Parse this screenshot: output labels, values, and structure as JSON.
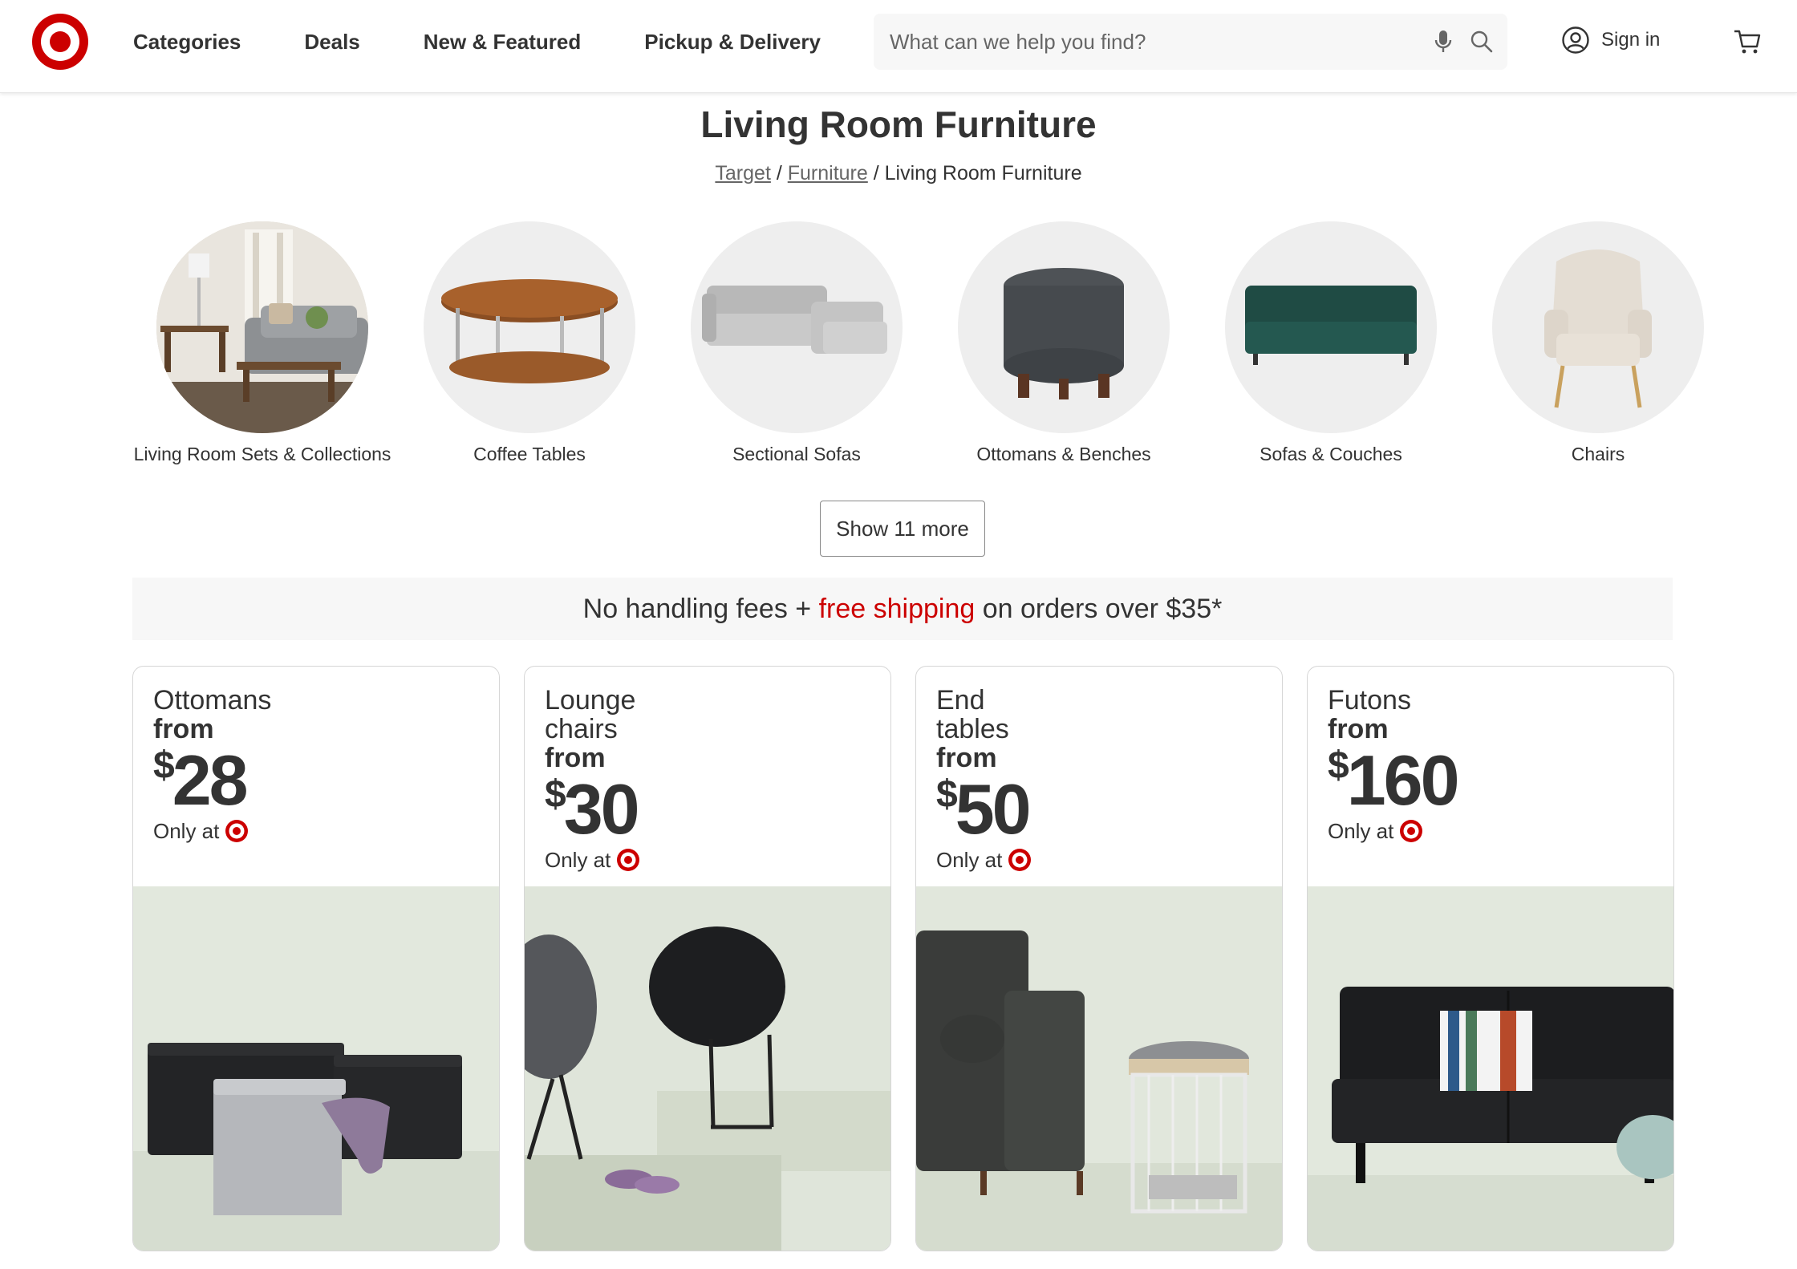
{
  "header": {
    "nav": [
      "Categories",
      "Deals",
      "New & Featured",
      "Pickup & Delivery"
    ],
    "search_placeholder": "What can we help you find?",
    "signin_label": "Sign in",
    "brand_color": "#cc0000"
  },
  "page": {
    "title": "Living Room Furniture",
    "breadcrumb": {
      "home": "Target",
      "parent": "Furniture",
      "current": "Living Room Furniture",
      "sep": "/"
    }
  },
  "categories": [
    {
      "label": "Living Room Sets & Collections"
    },
    {
      "label": "Coffee Tables"
    },
    {
      "label": "Sectional Sofas"
    },
    {
      "label": "Ottomans & Benches"
    },
    {
      "label": "Sofas & Couches"
    },
    {
      "label": "Chairs"
    }
  ],
  "show_more_label": "Show 11 more",
  "promo": {
    "prefix": "No handling fees + ",
    "highlight": "free shipping",
    "suffix": " on orders over $35*"
  },
  "deals": [
    {
      "name": "Ottomans",
      "from": "from",
      "dollar": "$",
      "price": "28",
      "only": "Only at"
    },
    {
      "name": "Lounge chairs",
      "from": "from",
      "dollar": "$",
      "price": "30",
      "only": "Only at"
    },
    {
      "name": "End tables",
      "from": "from",
      "dollar": "$",
      "price": "50",
      "only": "Only at"
    },
    {
      "name": "Futons",
      "from": "from",
      "dollar": "$",
      "price": "160",
      "only": "Only at"
    }
  ]
}
